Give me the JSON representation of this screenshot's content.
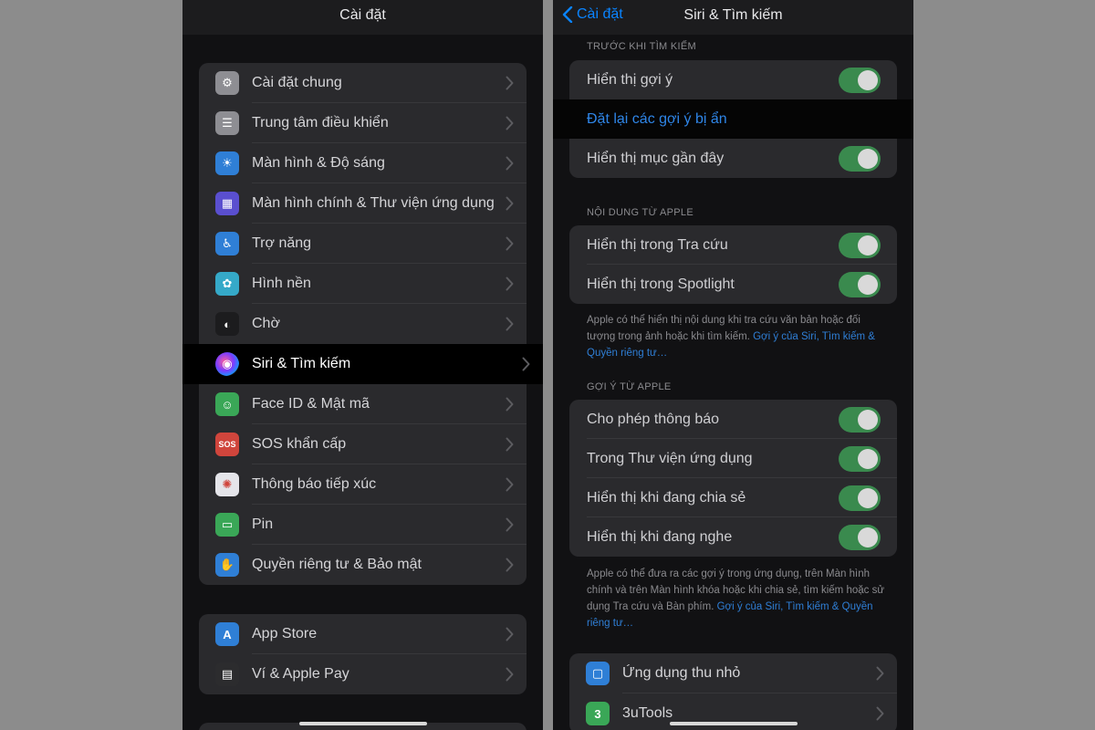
{
  "left": {
    "title": "Cài đặt",
    "group1": [
      {
        "label": "Cài đặt chung",
        "icon": "gear-icon",
        "color": "#8e8e93",
        "glyph": "⚙"
      },
      {
        "label": "Trung tâm điều khiển",
        "icon": "switches-icon",
        "color": "#8e8e93",
        "glyph": "☰"
      },
      {
        "label": "Màn hình & Độ sáng",
        "icon": "brightness-icon",
        "color": "#2f7fd6",
        "glyph": "☀"
      },
      {
        "label": "Màn hình chính & Thư viện ứng dụng",
        "icon": "home-grid-icon",
        "color": "#5a4fcf",
        "glyph": "▦"
      },
      {
        "label": "Trợ năng",
        "icon": "accessibility-icon",
        "color": "#2f7fd6",
        "glyph": "♿"
      },
      {
        "label": "Hình nền",
        "icon": "wallpaper-flower-icon",
        "color": "#35a9c8",
        "glyph": "✿"
      },
      {
        "label": "Chờ",
        "icon": "standby-icon",
        "color": "#1c1c1e",
        "glyph": "◐"
      },
      {
        "label": "Siri & Tìm kiếm",
        "icon": "siri-icon",
        "color": "#2a1a3a",
        "glyph": "◉",
        "highlight": true
      },
      {
        "label": "Face ID & Mật mã",
        "icon": "face-id-icon",
        "color": "#3aa757",
        "glyph": "☺"
      },
      {
        "label": "SOS khẩn cấp",
        "icon": "sos-icon",
        "color": "#d0453c",
        "glyph": "SOS"
      },
      {
        "label": "Thông báo tiếp xúc",
        "icon": "exposure-icon",
        "color": "#e5e5ea",
        "glyph": "✺"
      },
      {
        "label": "Pin",
        "icon": "battery-icon",
        "color": "#3aa757",
        "glyph": "▭"
      },
      {
        "label": "Quyền riêng tư & Bảo mật",
        "icon": "hand-icon",
        "color": "#2f7fd6",
        "glyph": "✋"
      }
    ],
    "group2": [
      {
        "label": "App Store",
        "icon": "app-store-icon",
        "color": "#2f7fd6",
        "glyph": "A"
      },
      {
        "label": "Ví & Apple Pay",
        "icon": "wallet-icon",
        "color": "#2c2c2e",
        "glyph": "▤"
      }
    ]
  },
  "right": {
    "back_label": "Cài đặt",
    "title": "Siri & Tìm kiếm",
    "section1_header": "TRƯỚC KHI TÌM KIẾM",
    "section1": [
      {
        "label": "Hiển thị gợi ý",
        "type": "toggle",
        "on": true
      },
      {
        "label": "Đặt lại các gợi ý bị ẩn",
        "type": "link"
      },
      {
        "label": "Hiển thị mục gần đây",
        "type": "toggle",
        "on": true
      }
    ],
    "section2_header": "NỘI DUNG TỪ APPLE",
    "section2": [
      {
        "label": "Hiển thị trong Tra cứu",
        "type": "toggle",
        "on": true
      },
      {
        "label": "Hiển thị trong Spotlight",
        "type": "toggle",
        "on": true
      }
    ],
    "section2_footer_text_1": "Apple có thể hiển thị nội dung khi tra cứu văn bản hoặc đối tượng trong ảnh hoặc khi tìm kiếm. ",
    "section2_footer_link": "Gợi ý của Siri, Tìm kiếm & Quyền riêng tư…",
    "section3_header": "GỢI Ý TỪ APPLE",
    "section3": [
      {
        "label": "Cho phép thông báo",
        "type": "toggle",
        "on": true
      },
      {
        "label": "Trong Thư viện ứng dụng",
        "type": "toggle",
        "on": true
      },
      {
        "label": "Hiển thị khi đang chia sẻ",
        "type": "toggle",
        "on": true
      },
      {
        "label": "Hiển thị khi đang nghe",
        "type": "toggle",
        "on": true
      }
    ],
    "section3_footer_text_1": "Apple có thể đưa ra các gợi ý trong ứng dụng, trên Màn hình chính và trên Màn hình khóa hoặc khi chia sẻ, tìm kiếm hoặc sử dụng Tra cứu và Bàn phím. ",
    "section3_footer_link": "Gợi ý của Siri, Tìm kiếm & Quyền riêng tư…",
    "apps": [
      {
        "label": "Ứng dụng thu nhỏ",
        "icon": "app-clips-icon",
        "color": "#2f7fd6",
        "glyph": "▢"
      },
      {
        "label": "3uTools",
        "icon": "3utools-icon",
        "color": "#3aa757",
        "glyph": "3"
      }
    ]
  },
  "colors": {
    "accent": "#0a84ff",
    "toggle_on": "#3a8a4e",
    "group_bg": "#2a2a2d",
    "page_bg": "#111113"
  }
}
